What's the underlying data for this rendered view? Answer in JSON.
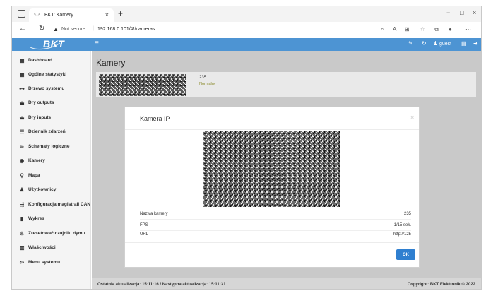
{
  "browser": {
    "tab_title": "BKT: Kamery",
    "tab_icon": "<·>",
    "tab_close": "×",
    "new_tab": "+",
    "security_label": "Not secure",
    "separator": "|",
    "url": "192.168.0.101/#!/cameras",
    "window_controls": {
      "minimize": "−",
      "maximize": "□",
      "close": "×"
    }
  },
  "header": {
    "logo": "BKT",
    "user": "guest",
    "accent_color": "#4d94d3"
  },
  "sidebar": {
    "items": [
      {
        "label": "Dashboard",
        "icon": "grid-icon"
      },
      {
        "label": "Ogólne statystyki",
        "icon": "grid-icon"
      },
      {
        "label": "Drzewo systemu",
        "icon": "tree-icon"
      },
      {
        "label": "Dry outputs",
        "icon": "relay-icon"
      },
      {
        "label": "Dry inputs",
        "icon": "relay-icon"
      },
      {
        "label": "Dziennik zdarzeń",
        "icon": "list-icon"
      },
      {
        "label": "Schematy logiczne",
        "icon": "link-icon"
      },
      {
        "label": "Kamery",
        "icon": "camera-icon"
      },
      {
        "label": "Mapa",
        "icon": "map-pin-icon"
      },
      {
        "label": "Użytkownicy",
        "icon": "user-icon"
      },
      {
        "label": "Konfiguracja magistrali CAN",
        "icon": "bus-icon"
      },
      {
        "label": "Wykres",
        "icon": "bar-chart-icon"
      },
      {
        "label": "Zresetować czujniki dymu",
        "icon": "smoke-icon"
      },
      {
        "label": "Właściwości",
        "icon": "properties-icon"
      },
      {
        "label": "Menu systemu",
        "icon": "menu-icon"
      }
    ]
  },
  "main": {
    "title": "Kamery",
    "camera": {
      "name": "235",
      "status": "Normalny"
    },
    "footer_left": "Ostatnia aktualizacja: 15:11:16 / Następna aktualizacja: 15:11:31",
    "footer_right": "Copyright: BKT Elektronik © 2022"
  },
  "modal": {
    "title": "Kamera IP",
    "close": "×",
    "rows": [
      {
        "label": "Nazwa kamery",
        "value": "235"
      },
      {
        "label": "FPS",
        "value": "1/15 sek."
      },
      {
        "label": "URL",
        "value": "http://125"
      }
    ],
    "ok_label": "OK"
  }
}
